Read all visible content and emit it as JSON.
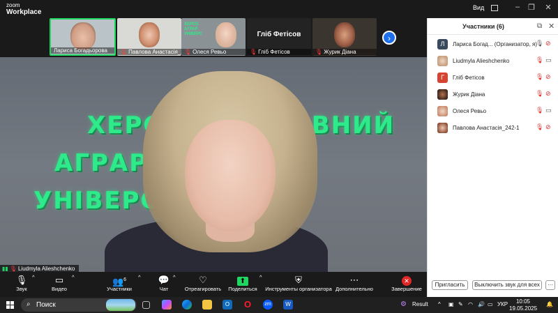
{
  "app": {
    "logo_line1": "zoom",
    "logo_line2": "Workplace",
    "view_label": "Вид"
  },
  "gallery": [
    {
      "name": "Лариса Богадьорова",
      "muted": false,
      "active": true
    },
    {
      "name": "Павлова Анастасія_2...",
      "muted": true
    },
    {
      "name": "Олеся Ревьо",
      "muted": true
    },
    {
      "name": "Гліб Фетісов",
      "muted": true,
      "center_name": "Гліб Фетісов"
    },
    {
      "name": "Журик Діана",
      "muted": true
    }
  ],
  "main_video": {
    "speaker_name": "Liudmyla Alieshchenko",
    "background_text": [
      "ХЕРС      Й ДЕРЖАВНИЙ",
      "АГРАР         ОМІЧНИЙ",
      "УНІВЕРС"
    ]
  },
  "toolbar": {
    "audio": "Звук",
    "video": "Видео",
    "participants": "Участники",
    "participants_count": "6",
    "chat": "Чат",
    "react": "Отреагировать",
    "share": "Поделиться",
    "host_tools": "Инструменты организатора",
    "more": "Дополнительно",
    "end": "Завершение"
  },
  "panel": {
    "title": "Участники (6)",
    "participants": [
      {
        "initial": "Л",
        "name": "Лариса Богад...  (Организатор, я)",
        "color": "#3a4a5e",
        "muted": false,
        "photo": false
      },
      {
        "initial": "",
        "name": "Liudmyla Alieshchenko",
        "color": "#c9a07f",
        "muted": true,
        "photo": true
      },
      {
        "initial": "Г",
        "name": "Гліб Фетісов",
        "color": "#d64531",
        "muted": true,
        "photo": false
      },
      {
        "initial": "",
        "name": "Журик Діана",
        "color": "#6a3c2c",
        "muted": true,
        "photo": true
      },
      {
        "initial": "",
        "name": "Олеся Ревьо",
        "color": "#d7a084",
        "muted": true,
        "photo": true
      },
      {
        "initial": "",
        "name": "Павлова Анастасія_242-1",
        "color": "#b0664c",
        "muted": true,
        "photo": true
      }
    ],
    "invite": "Пригласить",
    "mute_all": "Выключить звук для всех",
    "more": "···"
  },
  "taskbar": {
    "search": "Поиск",
    "result_label": "Result",
    "lang": "УКР",
    "time": "10:05",
    "date": "19.05.2025"
  },
  "colors": {
    "accent_green": "#1ed760",
    "muted_red": "#e02828",
    "blue_btn": "#1f6feb",
    "uni_green": "#2eea8a"
  }
}
